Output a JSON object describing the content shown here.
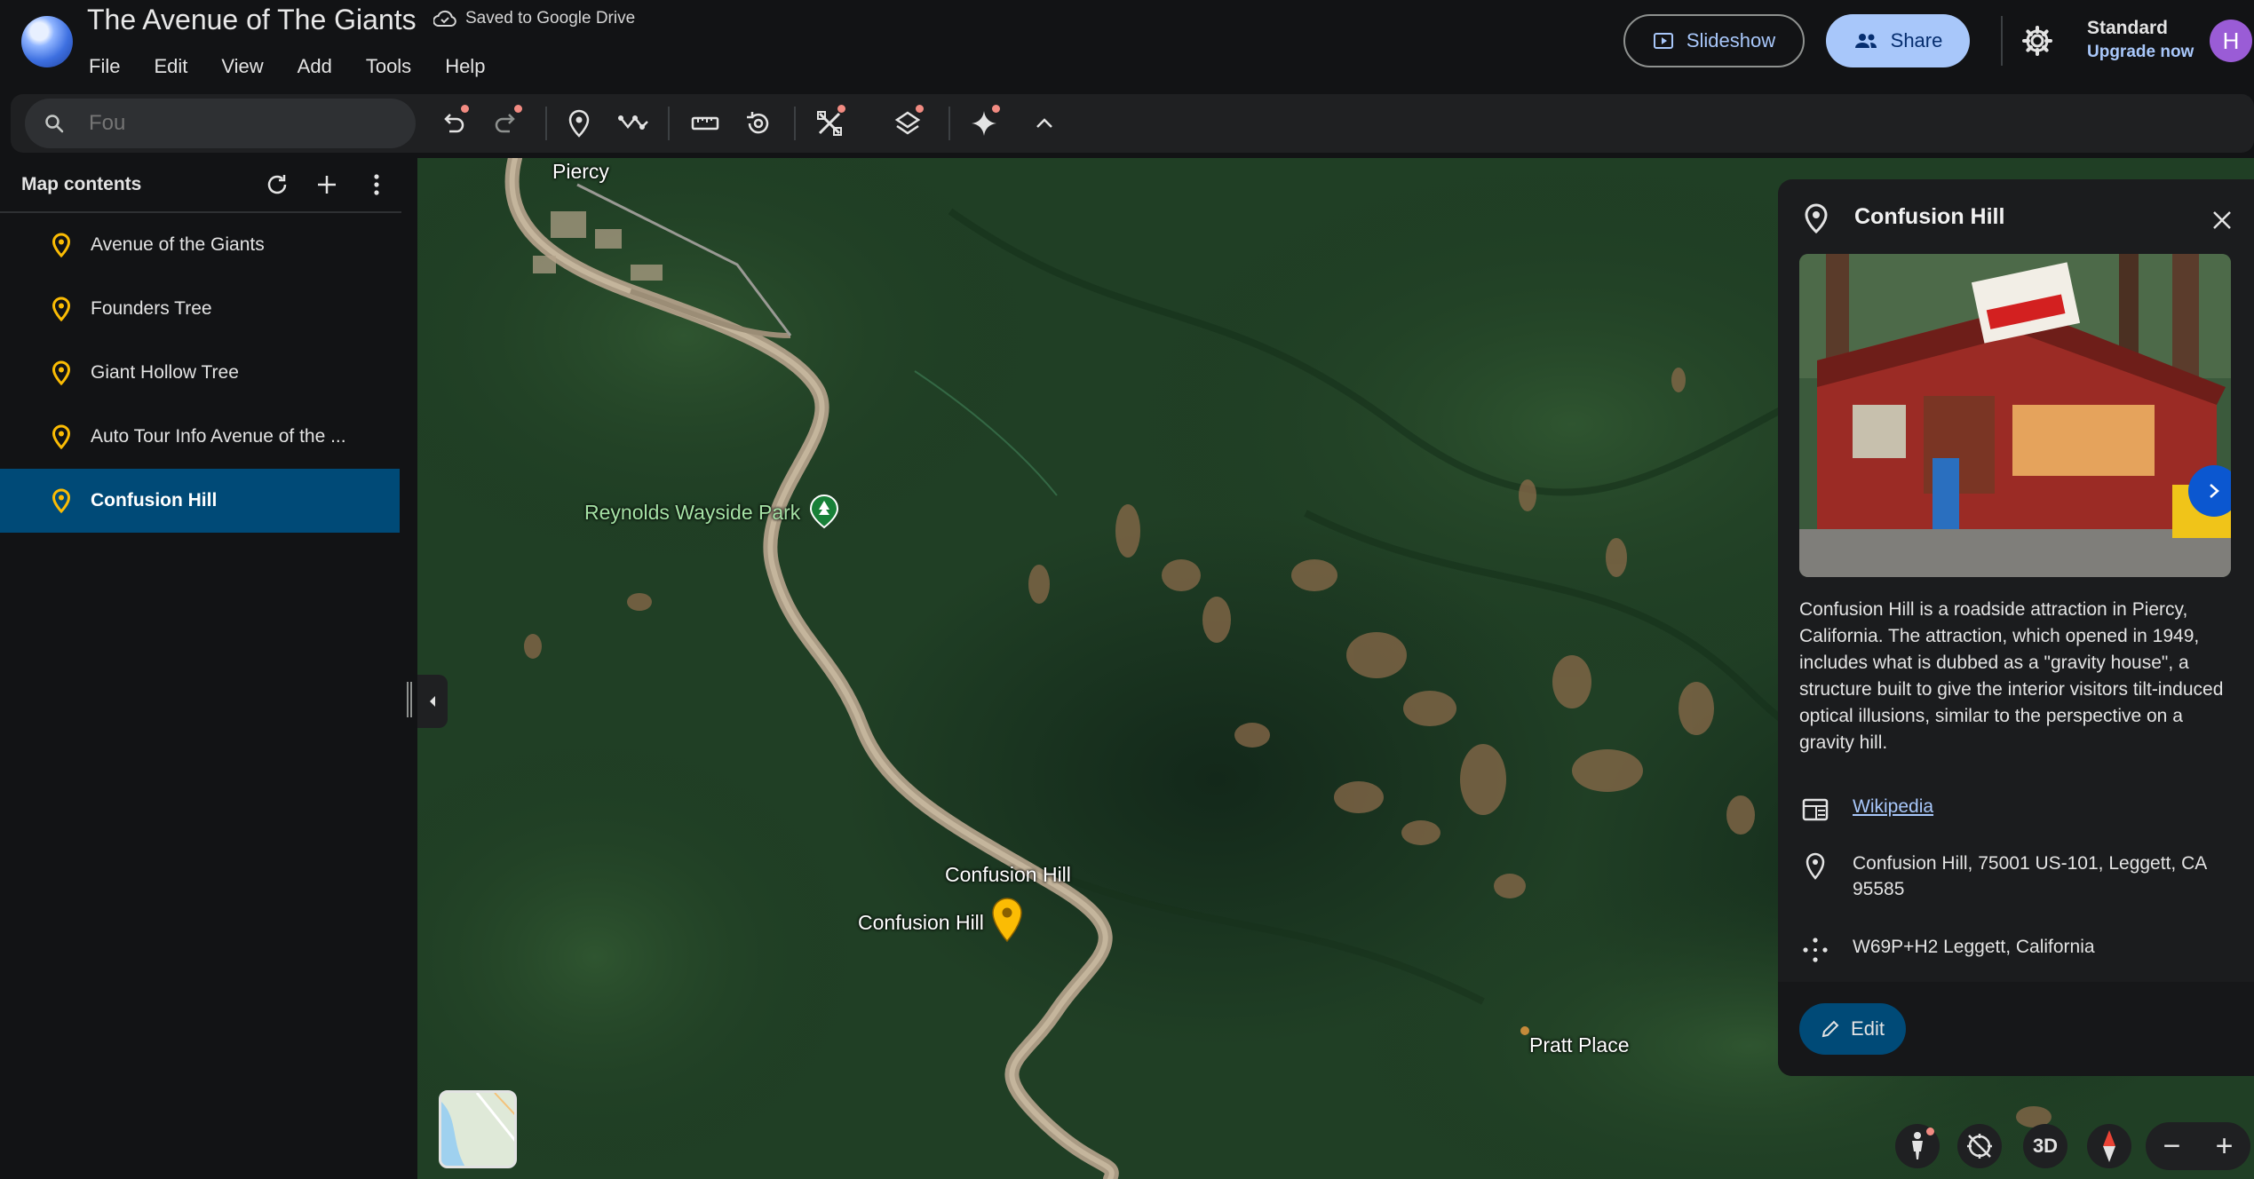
{
  "header": {
    "title": "The Avenue of The Giants",
    "saved_status": "Saved to Google Drive",
    "menu": [
      "File",
      "Edit",
      "View",
      "Add",
      "Tools",
      "Help"
    ],
    "slideshow_label": "Slideshow",
    "share_label": "Share",
    "plan_name": "Standard",
    "upgrade_label": "Upgrade now",
    "avatar_initial": "H"
  },
  "toolbar": {
    "search_value": "",
    "search_placeholder": "Fou",
    "icons": [
      "undo-icon",
      "redo-icon",
      "add-placemark-icon",
      "draw-path-icon",
      "ruler-icon",
      "historical-imagery-icon",
      "map-style-icon",
      "layers-icon",
      "gemini-sparkle-icon",
      "collapse-toolbar-icon"
    ]
  },
  "sidebar": {
    "heading": "Map contents",
    "items": [
      {
        "label": "Avenue of the Giants"
      },
      {
        "label": "Founders Tree"
      },
      {
        "label": "Giant Hollow Tree"
      },
      {
        "label": "Auto Tour Info Avenue of the ..."
      },
      {
        "label": "Confusion Hill"
      }
    ],
    "active_index": 4,
    "pin_color": "#fbbc04"
  },
  "map": {
    "labels": {
      "piercy": "Piercy",
      "reynolds": "Reynolds Wayside Park",
      "confusion_hill_upper": "Confusion Hill",
      "confusion_hill_lower": "Confusion Hill",
      "pratt": "Pratt Place"
    },
    "controls": {
      "three_d": "3D",
      "zoom_out": "−",
      "zoom_in": "+"
    }
  },
  "panel": {
    "title": "Confusion Hill",
    "description": "Confusion Hill is a roadside attraction in Piercy, California. The attraction, which opened in 1949, includes what is dubbed as a \"gravity house\", a structure built to give the interior visitors tilt-induced optical illusions, similar to the perspective on a gravity hill.",
    "source_link": "Wikipedia",
    "address": "Confusion Hill, 75001 US-101, Leggett, CA 95585",
    "plus_code": "W69P+H2 Leggett, California",
    "edit_label": "Edit"
  },
  "colors": {
    "accent_blue": "#a8c7fa",
    "active_row": "#004a77",
    "edit_button": "#004a77",
    "notification_dot": "#f28b82"
  }
}
